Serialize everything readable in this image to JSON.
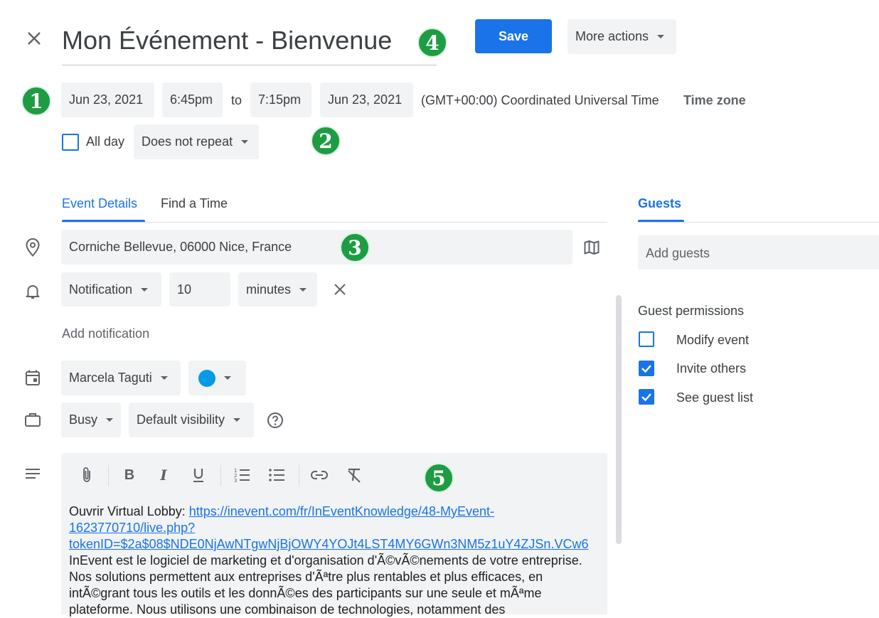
{
  "header": {
    "title": "Mon Événement - Bienvenue",
    "save_label": "Save",
    "more_actions_label": "More actions"
  },
  "datetime": {
    "start_date": "Jun 23, 2021",
    "start_time": "6:45pm",
    "to_label": "to",
    "end_time": "7:15pm",
    "end_date": "Jun 23, 2021",
    "timezone_text": "(GMT+00:00) Coordinated Universal Time",
    "timezone_button": "Time zone",
    "all_day_label": "All day",
    "repeat_label": "Does not repeat"
  },
  "tabs": {
    "event_details": "Event Details",
    "find_a_time": "Find a Time",
    "guests": "Guests"
  },
  "details": {
    "location": "Corniche Bellevue, 06000 Nice, France",
    "notification_type": "Notification",
    "notification_value": "10",
    "notification_unit": "minutes",
    "add_notification": "Add notification",
    "calendar_owner": "Marcela Taguti",
    "calendar_color": "#039be5",
    "availability": "Busy",
    "visibility": "Default visibility"
  },
  "description": {
    "prefix": "Ouvrir Virtual Lobby: ",
    "link": "https://inevent.com/fr/InEventKnowledge/48-MyEvent-1623770710/live.php?tokenID=$2a$08$NDE0NjAwNTgwNjBjOWY4YOJt4LST4MY6GWn3NM5z1uY4ZJSn.VCw6",
    "body": " InEvent est le logiciel de marketing et d'organisation d'Ã©vÃ©nements de votre entreprise. Nos solutions permettent aux entreprises d'Ãªtre plus rentables et plus efficaces, en intÃ©grant tous les outils et les donnÃ©es des participants sur une seule et mÃªme plateforme. Nous utilisons une combinaison de technologies, notamment des"
  },
  "guests": {
    "add_placeholder": "Add guests",
    "permissions_title": "Guest permissions",
    "permissions": [
      {
        "label": "Modify event",
        "checked": false
      },
      {
        "label": "Invite others",
        "checked": true
      },
      {
        "label": "See guest list",
        "checked": true
      }
    ]
  },
  "badges": [
    "1",
    "2",
    "3",
    "4",
    "5"
  ],
  "colors": {
    "accent": "#1a73e8",
    "badge": "#1e9c43",
    "chip_bg": "#f1f3f4"
  }
}
